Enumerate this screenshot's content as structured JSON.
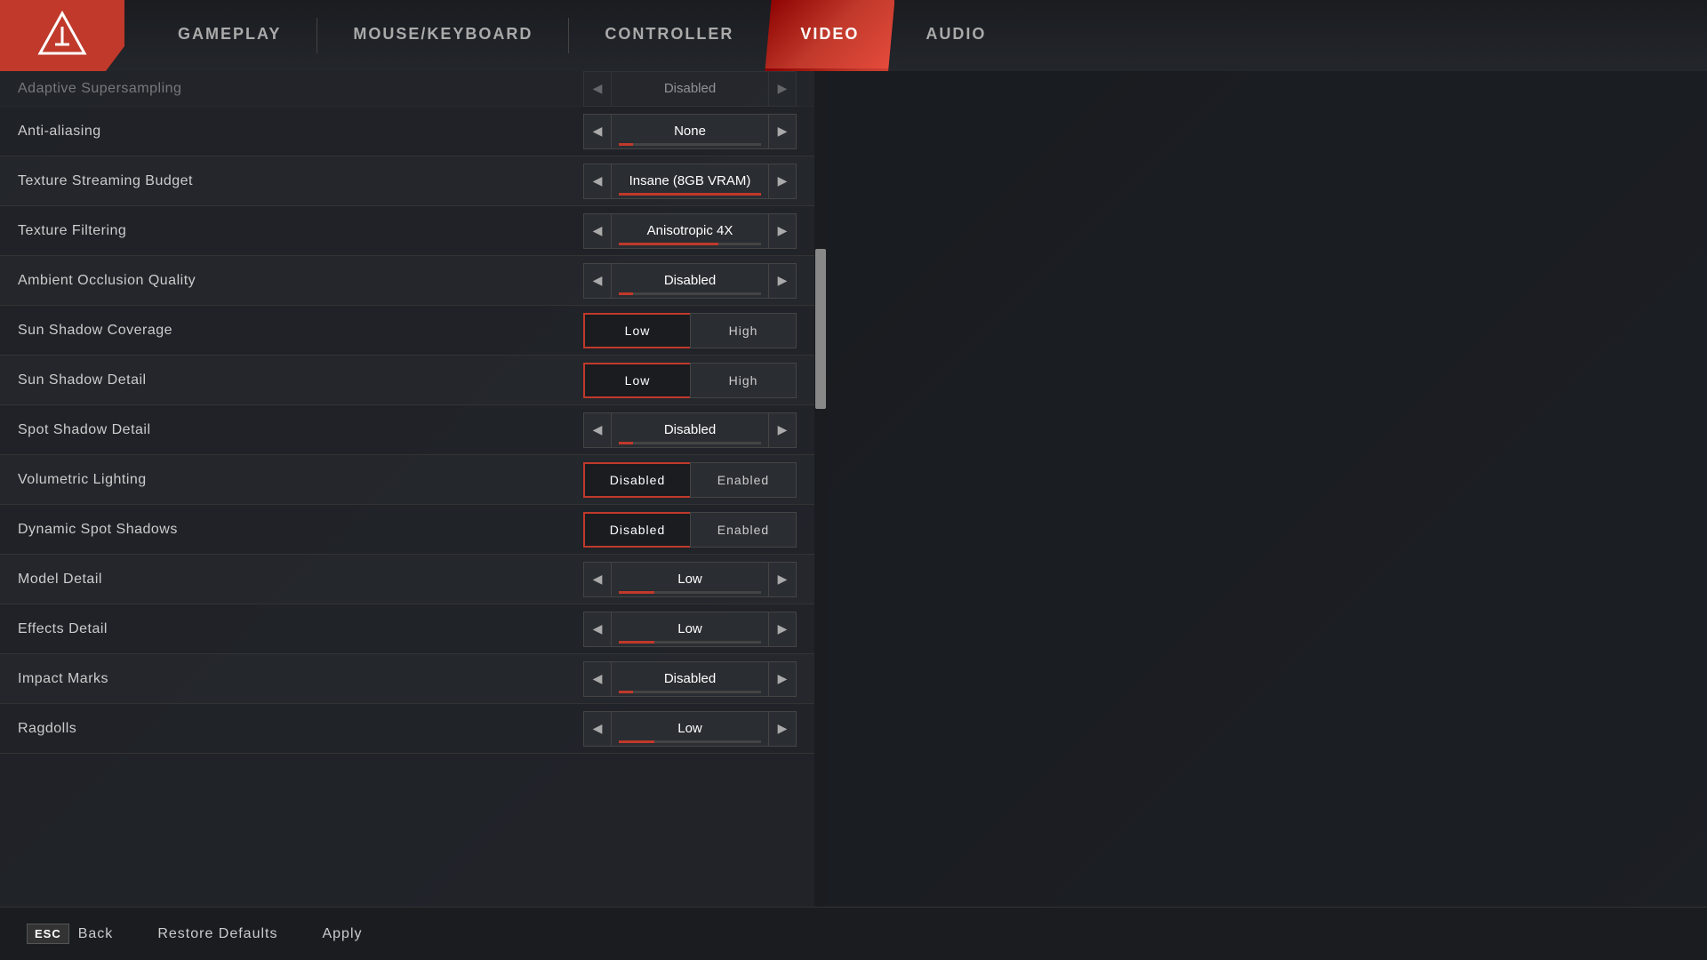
{
  "nav": {
    "tabs": [
      {
        "id": "gameplay",
        "label": "GAMEPLAY",
        "active": false
      },
      {
        "id": "mouse-keyboard",
        "label": "MOUSE/KEYBOARD",
        "active": false
      },
      {
        "id": "controller",
        "label": "CONTROLLER",
        "active": false
      },
      {
        "id": "video",
        "label": "VIDEO",
        "active": true
      },
      {
        "id": "audio",
        "label": "AUDIO",
        "active": false
      }
    ]
  },
  "settings": {
    "partial_label": "Adaptive Supersampling",
    "partial_value": "Disabled",
    "rows": [
      {
        "id": "anti-aliasing",
        "label": "Anti-aliasing",
        "type": "arrow",
        "value": "None",
        "bar_pct": 10
      },
      {
        "id": "texture-streaming",
        "label": "Texture Streaming Budget",
        "type": "arrow",
        "value": "Insane (8GB VRAM)",
        "bar_pct": 100
      },
      {
        "id": "texture-filtering",
        "label": "Texture Filtering",
        "type": "arrow",
        "value": "Anisotropic 4X",
        "bar_pct": 70
      },
      {
        "id": "ambient-occlusion",
        "label": "Ambient Occlusion Quality",
        "type": "arrow",
        "value": "Disabled",
        "bar_pct": 10
      },
      {
        "id": "sun-shadow-coverage",
        "label": "Sun Shadow Coverage",
        "type": "toggle",
        "options": [
          "Low",
          "High"
        ],
        "selected": 0
      },
      {
        "id": "sun-shadow-detail",
        "label": "Sun Shadow Detail",
        "type": "toggle",
        "options": [
          "Low",
          "High"
        ],
        "selected": 0
      },
      {
        "id": "spot-shadow-detail",
        "label": "Spot Shadow Detail",
        "type": "arrow",
        "value": "Disabled",
        "bar_pct": 10
      },
      {
        "id": "volumetric-lighting",
        "label": "Volumetric Lighting",
        "type": "toggle",
        "options": [
          "Disabled",
          "Enabled"
        ],
        "selected": 0
      },
      {
        "id": "dynamic-spot-shadows",
        "label": "Dynamic Spot Shadows",
        "type": "toggle",
        "options": [
          "Disabled",
          "Enabled"
        ],
        "selected": 0
      },
      {
        "id": "model-detail",
        "label": "Model Detail",
        "type": "arrow",
        "value": "Low",
        "bar_pct": 25
      },
      {
        "id": "effects-detail",
        "label": "Effects Detail",
        "type": "arrow",
        "value": "Low",
        "bar_pct": 25
      },
      {
        "id": "impact-marks",
        "label": "Impact Marks",
        "type": "arrow",
        "value": "Disabled",
        "bar_pct": 10
      },
      {
        "id": "ragdolls",
        "label": "Ragdolls",
        "type": "arrow",
        "value": "Low",
        "bar_pct": 25
      }
    ]
  },
  "bottom": {
    "back_key": "ESC",
    "back_label": "Back",
    "restore_label": "Restore Defaults",
    "apply_label": "Apply"
  }
}
